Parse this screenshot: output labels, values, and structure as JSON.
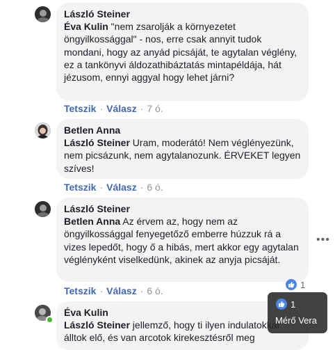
{
  "comments": [
    {
      "author": "László Steiner",
      "mention": "Éva Kulin",
      "text": " \"nem zsarolják a környezetet öngyilkossággal\" - nos, erre csak annyit tudok mondani, hogy az anyád picsáját, te agytalan véglény, ez a tankönyvi áldozathibáztatás mintapéldája, hát jézusom, ennyi aggyal hogy lehet járni?",
      "like_label": "Tetszik",
      "reply_label": "Válasz",
      "time": "7 ó."
    },
    {
      "author": "Betlen Anna",
      "mention": "László Steiner",
      "text": " Uram, moderátó! Nem véglényezünk, nem picsázunk, nem agytalanozunk. ÉRVEKET legyen szíves!",
      "like_label": "Tetszik",
      "reply_label": "Válasz",
      "time": "6 ó."
    },
    {
      "author": "László Steiner",
      "mention": "Betlen Anna",
      "text": " Az érvem az, hogy nem az öngyilkossággal fenyegetőző emberre húzzuk rá a vizes lepedőt, hogy ő a hibás, mert akkor egy agytalan véglényként viselkedünk, akinek az anyja picsáját.",
      "like_label": "Tetszik",
      "reply_label": "Válasz",
      "time": "6 ó.",
      "reaction_count": "1",
      "more_icon": "more-options-icon"
    },
    {
      "author": "Éva Kulin",
      "mention": "László Steiner",
      "text": " jellemző, hogy ti ilyen indulatokkal álltok elő, és van arcotok kirekesztésről meg"
    }
  ],
  "tooltip": {
    "count": "1",
    "name": "Mérő Vera"
  },
  "colors": {
    "bubble": "#f2f3f5",
    "link": "#4267b2",
    "like": "#4a86e8"
  }
}
